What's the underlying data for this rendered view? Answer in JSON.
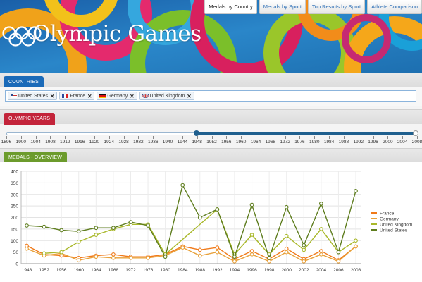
{
  "header": {
    "title": "Olympic Games",
    "tabs": [
      {
        "label": "Medals by Country",
        "active": true
      },
      {
        "label": "Medals by Sport",
        "active": false
      },
      {
        "label": "Top Results by Sport",
        "active": false
      },
      {
        "label": "Athlete Comparison",
        "active": false
      }
    ]
  },
  "countries": {
    "section_label": "COUNTRIES",
    "selected": [
      {
        "label": "United States",
        "flag": "us-flag-icon"
      },
      {
        "label": "France",
        "flag": "france-flag-icon"
      },
      {
        "label": "Germany",
        "flag": "germany-flag-icon"
      },
      {
        "label": "United Kingdom",
        "flag": "uk-flag-icon"
      }
    ],
    "remove_glyph": "✕"
  },
  "years": {
    "section_label": "OLYMPIC YEARS",
    "ticks": [
      "1896",
      "1900",
      "1904",
      "1908",
      "1912",
      "1916",
      "1920",
      "1924",
      "1928",
      "1932",
      "1936",
      "1940",
      "1944",
      "1948",
      "1952",
      "1956",
      "1960",
      "1964",
      "1968",
      "1972",
      "1976",
      "1980",
      "1984",
      "1988",
      "1992",
      "1996",
      "2000",
      "2004",
      "2008"
    ],
    "range_start": "1948",
    "range_end": "2008"
  },
  "medals": {
    "section_label": "MEDALS - OVERVIEW"
  },
  "colors": {
    "france": "#f07a1a",
    "germany": "#e8a13a",
    "uk": "#a9b82a",
    "us": "#5e7d1e",
    "blue_tab": "#1a6ab8",
    "red_tab": "#c3243a",
    "green_tab": "#6c9b2c"
  },
  "chart_data": {
    "type": "line",
    "categories": [
      "1948",
      "1952",
      "1956",
      "1960",
      "1964",
      "1968",
      "1972",
      "1976",
      "1980",
      "1984",
      "1988",
      "1992",
      "1994",
      "1996",
      "1998",
      "2000",
      "2002",
      "2004",
      "2006",
      "2008"
    ],
    "ylim": [
      0,
      400
    ],
    "yticks": [
      0,
      50,
      100,
      150,
      200,
      250,
      300,
      350,
      400
    ],
    "legend_position": "right",
    "series": [
      {
        "name": "France",
        "values": [
          78,
          40,
          35,
          25,
          35,
          40,
          30,
          30,
          40,
          75,
          60,
          70,
          20,
          55,
          20,
          65,
          20,
          55,
          15,
          75
        ]
      },
      {
        "name": "Germany",
        "values": [
          65,
          35,
          45,
          15,
          30,
          25,
          25,
          25,
          35,
          70,
          35,
          50,
          10,
          40,
          10,
          50,
          10,
          40,
          10,
          75
        ]
      },
      {
        "name": "United Kingdom",
        "values": [
          null,
          45,
          50,
          95,
          125,
          150,
          170,
          170,
          40,
          null,
          null,
          235,
          40,
          125,
          40,
          120,
          60,
          150,
          50,
          100
        ]
      },
      {
        "name": "United States",
        "values": [
          165,
          160,
          145,
          140,
          155,
          155,
          180,
          165,
          30,
          340,
          200,
          235,
          30,
          255,
          25,
          245,
          80,
          260,
          50,
          315
        ]
      }
    ]
  }
}
